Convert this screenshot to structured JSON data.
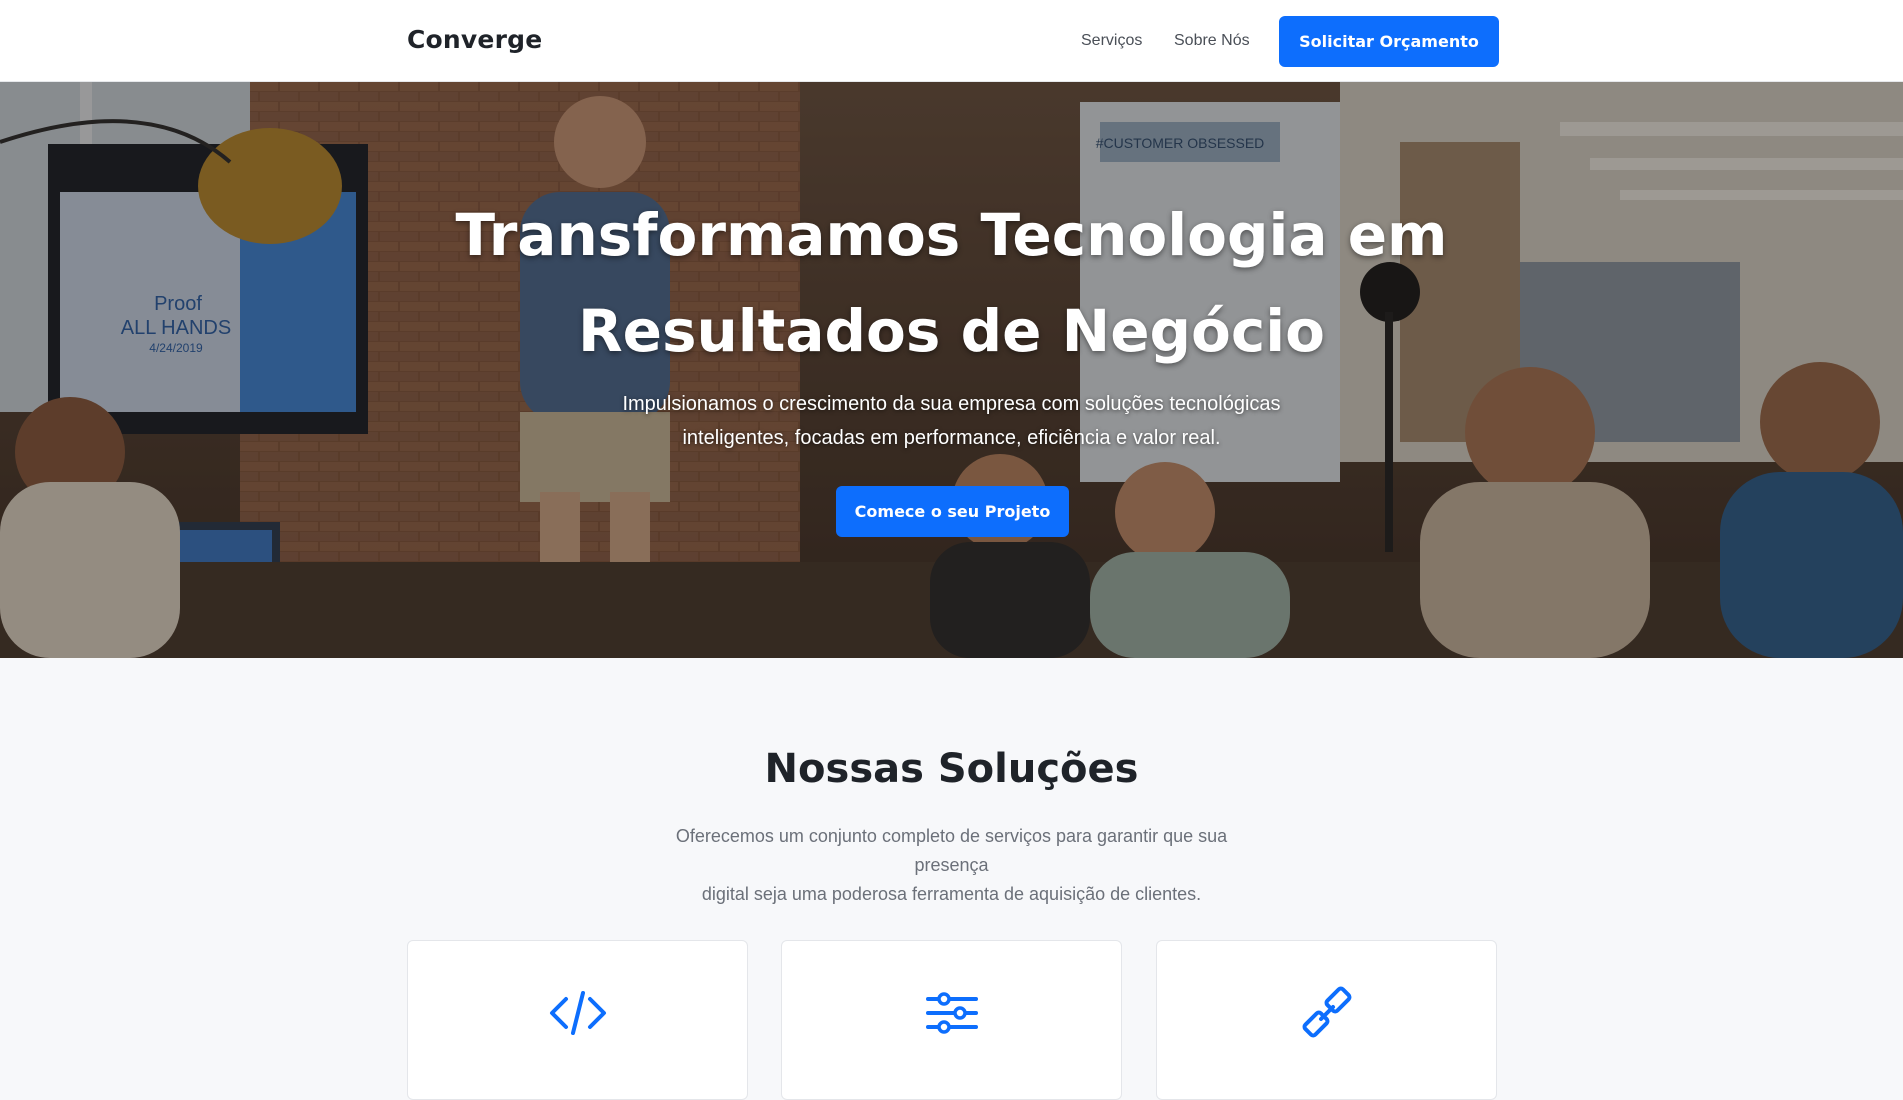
{
  "header": {
    "logo": "Converge",
    "nav": {
      "services": "Serviços",
      "about": "Sobre Nós"
    },
    "cta": "Solicitar Orçamento"
  },
  "hero": {
    "title_line1": "Transformamos Tecnologia em",
    "title_line2": "Resultados de Negócio",
    "subtitle_line1": "Impulsionamos o crescimento da sua empresa com soluções tecnológicas",
    "subtitle_line2": "inteligentes, focadas em performance, eficiência e valor real.",
    "cta": "Comece o seu Projeto",
    "photo_screen_text": [
      "Proof",
      "ALL HANDS",
      "4/24/2019"
    ],
    "photo_banner_text": "#CUSTOMER OBSESSED"
  },
  "solutions": {
    "title": "Nossas Soluções",
    "description_line1": "Oferecemos um conjunto completo de serviços para garantir que sua presença",
    "description_line2": "digital seja uma poderosa ferramenta de aquisição de clientes.",
    "cards": [
      {
        "icon": "code-icon"
      },
      {
        "icon": "sliders-icon"
      },
      {
        "icon": "pencil-icon"
      }
    ]
  },
  "colors": {
    "accent": "#0d6efd",
    "section_bg": "#f7f8fa",
    "text_dark": "#1f2329",
    "text_muted": "#6b7079"
  }
}
